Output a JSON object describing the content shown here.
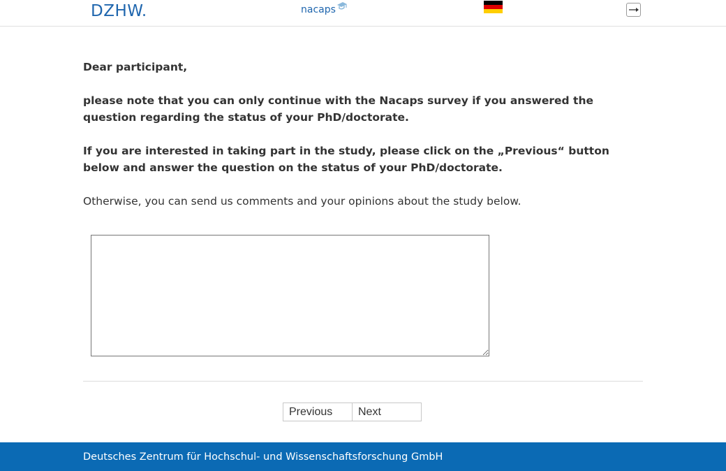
{
  "header": {
    "logo_dzhw": "DZHW.",
    "logo_nacaps": "nacaps",
    "flag_icon": "german-flag-icon",
    "logout_icon": "arrow-right-icon"
  },
  "main": {
    "greeting": "Dear participant,",
    "paragraph1": "please note that you can only continue with the Nacaps survey if you answered the question regarding the status of your PhD/doctorate.",
    "paragraph2": "If you are interested in taking part in the study, please click on the „Previous“ button below and answer the question on the status of your PhD/doctorate.",
    "paragraph3": "Otherwise, you can send us comments and your opinions about the study below.",
    "comment_value": ""
  },
  "nav": {
    "previous_label": "Previous",
    "next_label": "Next"
  },
  "footer": {
    "text": "Deutsches Zentrum für Hochschul- und Wissenschaftsforschung GmbH"
  },
  "colors": {
    "brand_blue": "#1f66ae",
    "footer_blue": "#0b6ab4",
    "text": "#333333"
  }
}
